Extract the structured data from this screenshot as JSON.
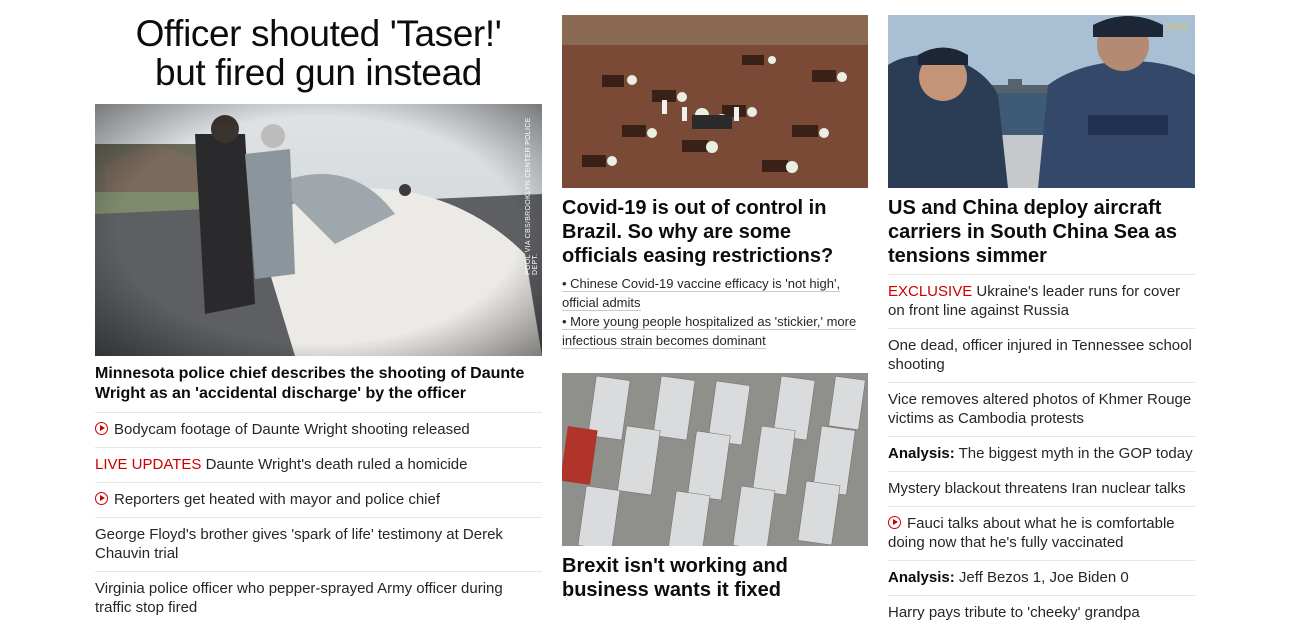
{
  "lead": {
    "headline_line1": "Officer shouted 'Taser!'",
    "headline_line2": "but fired gun instead",
    "image_caption": "POOL VIA CBS/BROOKLYN CENTER POLICE DEPT.",
    "title": "Minnesota police chief describes the shooting of Daunte Wright as an 'accidental discharge' by the officer",
    "items": [
      {
        "prefix": "",
        "text": "Bodycam footage of Daunte Wright shooting released",
        "video": true
      },
      {
        "prefix": "LIVE UPDATES",
        "text": " Daunte Wright's death ruled a homicide",
        "video": false
      },
      {
        "prefix": "",
        "text": "Reporters get heated with mayor and police chief",
        "video": true
      },
      {
        "prefix": "",
        "text": "George Floyd's brother gives 'spark of life' testimony at Derek Chauvin trial",
        "video": false
      },
      {
        "prefix": "",
        "text": "Virginia police officer who pepper-sprayed Army officer during traffic stop fired",
        "video": false
      }
    ]
  },
  "middle": {
    "story1": {
      "title": "Covid-19 is out of control in Brazil. So why are some officials easing restrictions?",
      "bullets": [
        "• Chinese Covid-19 vaccine efficacy is 'not high', official admits",
        "• More young people hospitalized as 'stickier,' more infectious strain becomes dominant"
      ]
    },
    "story2": {
      "title": "Brexit isn't working and business wants it fixed"
    }
  },
  "right": {
    "story": {
      "title": "US and China deploy aircraft carriers in South China Sea as tensions simmer",
      "badge": "DDG 89"
    },
    "items": [
      {
        "prefix": "EXCLUSIVE",
        "prefix_style": "red",
        "text": " Ukraine's leader runs for cover on front line against Russia",
        "video": false
      },
      {
        "prefix": "",
        "prefix_style": "",
        "text": "One dead, officer injured in Tennessee school shooting",
        "video": false
      },
      {
        "prefix": "",
        "prefix_style": "",
        "text": "Vice removes altered photos of Khmer Rouge victims as Cambodia protests",
        "video": false
      },
      {
        "prefix": "Analysis:",
        "prefix_style": "bold",
        "text": " The biggest myth in the GOP today",
        "video": false
      },
      {
        "prefix": "",
        "prefix_style": "",
        "text": "Mystery blackout threatens Iran nuclear talks",
        "video": false
      },
      {
        "prefix": "",
        "prefix_style": "",
        "text": "Fauci talks about what he is comfortable doing now that he's fully vaccinated",
        "video": true
      },
      {
        "prefix": "Analysis:",
        "prefix_style": "bold",
        "text": " Jeff Bezos 1, Joe Biden 0",
        "video": false
      },
      {
        "prefix": "",
        "prefix_style": "",
        "text": "Harry pays tribute to 'cheeky' grandpa",
        "video": false
      }
    ]
  },
  "colors": {
    "accent_red": "#cc0000",
    "text": "#262626",
    "divider": "#e6e6e6"
  }
}
